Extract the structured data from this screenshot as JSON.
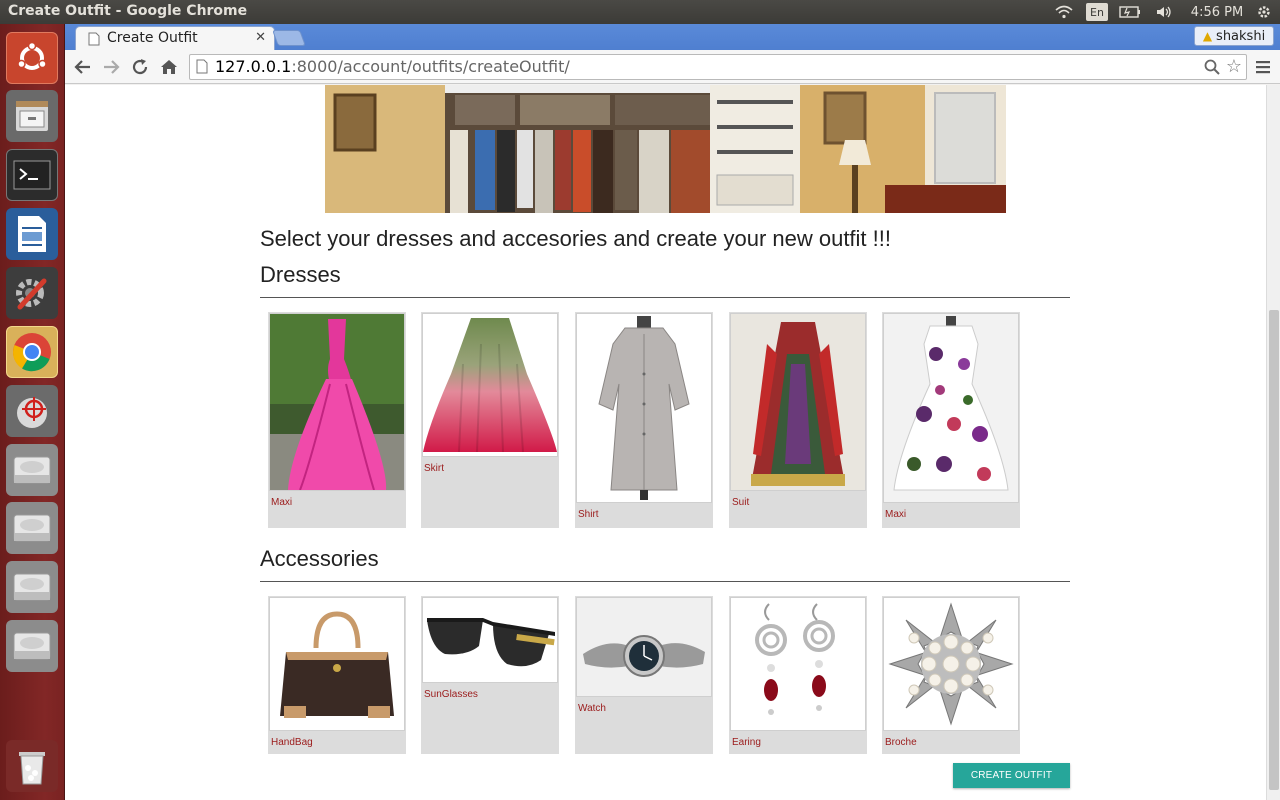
{
  "os": {
    "window_title": "Create Outfit - Google Chrome",
    "keyboard": "En",
    "clock": "4:56 PM"
  },
  "browser": {
    "tab_title": "Create Outfit",
    "user_name": "shakshi",
    "url_host": "127.0.0.1",
    "url_path": ":8000/account/outfits/createOutfit/"
  },
  "page": {
    "intro": "Select your dresses and accesories and create your new outfit !!!",
    "dresses_heading": "Dresses",
    "accessories_heading": "Accessories",
    "dresses": [
      {
        "label": "Maxi",
        "icon": "pink-gown-image"
      },
      {
        "label": "Skirt",
        "icon": "ombre-skirt-image"
      },
      {
        "label": "Shirt",
        "icon": "grey-shirt-dress-image"
      },
      {
        "label": "Suit",
        "icon": "anarkali-suit-image"
      },
      {
        "label": "Maxi",
        "icon": "floral-dress-image"
      }
    ],
    "accessories": [
      {
        "label": "HandBag",
        "icon": "handbag-image"
      },
      {
        "label": "SunGlasses",
        "icon": "sunglasses-image"
      },
      {
        "label": "Watch",
        "icon": "watch-image"
      },
      {
        "label": "Earing",
        "icon": "earrings-image"
      },
      {
        "label": "Broche",
        "icon": "brooch-image"
      }
    ],
    "create_button": "CREATE OUTFIT"
  },
  "colors": {
    "accent": "#26a69a",
    "label": "#9b1b1b",
    "launcher": "#822726",
    "tabstrip": "#5a8ad9"
  }
}
